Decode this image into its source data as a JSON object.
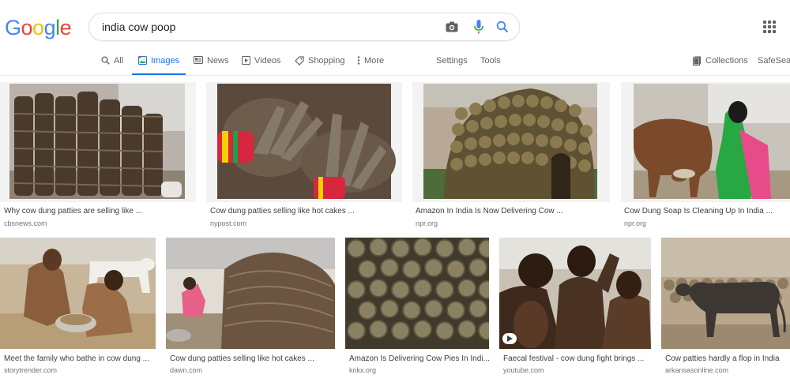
{
  "logo": {
    "letters": [
      "G",
      "o",
      "o",
      "g",
      "l",
      "e"
    ]
  },
  "search": {
    "query": "india cow poop"
  },
  "colors": {
    "accent": "#1a73e8",
    "blue": "#4285f4",
    "red": "#ea4335",
    "yellow": "#fbbc05",
    "green": "#34a853"
  },
  "tabs": {
    "all": "All",
    "images": "Images",
    "news": "News",
    "videos": "Videos",
    "shopping": "Shopping",
    "more": "More",
    "settings": "Settings",
    "tools": "Tools",
    "collections": "Collections",
    "safesearch": "SafeSear"
  },
  "results": [
    {
      "caption": "Why cow dung patties are selling like ...",
      "source": "cbsnews.com"
    },
    {
      "caption": "Cow dung patties selling like hot cakes ...",
      "source": "nypost.com"
    },
    {
      "caption": "Amazon In India Is Now Delivering Cow ...",
      "source": "npr.org"
    },
    {
      "caption": "Cow Dung Soap Is Cleaning Up In India ...",
      "source": "npr.org"
    },
    {
      "caption": "Meet the family who bathe in cow dung ...",
      "source": "storytrender.com"
    },
    {
      "caption": "Cow dung patties selling like hot cakes ...",
      "source": "dawn.com"
    },
    {
      "caption": "Amazon Is Delivering Cow Pies In Indi...",
      "source": "knkx.org"
    },
    {
      "caption": "Faecal festival - cow dung fight brings ...",
      "source": "youtube.com"
    },
    {
      "caption": "Cow patties hardly a flop in India",
      "source": "arkansasonline.com"
    }
  ]
}
